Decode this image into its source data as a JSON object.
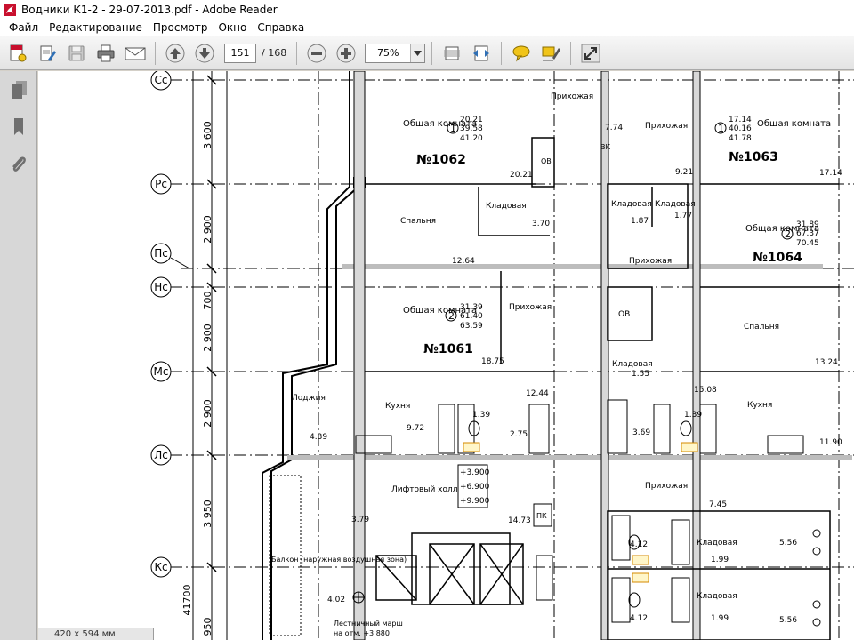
{
  "window": {
    "title": "Водники К1-2 - 29-07-2013.pdf - Adobe Reader"
  },
  "menu": [
    "Файл",
    "Редактирование",
    "Просмотр",
    "Окно",
    "Справка"
  ],
  "toolbar": {
    "page_current": "151",
    "page_total": "/ 168",
    "zoom": "75%"
  },
  "status": {
    "page_size": "420 x 594 мм"
  },
  "colors": {
    "accent": "#2f6fb5",
    "sticky_note": "#f0c419",
    "toolbar_bg": "#ebebeb"
  },
  "drawing": {
    "axes": [
      {
        "label": "Сс"
      },
      {
        "label": "Рс"
      },
      {
        "label": "Пс"
      },
      {
        "label": "Нс"
      },
      {
        "label": "Мс"
      },
      {
        "label": "Лс"
      },
      {
        "label": "Кс"
      }
    ],
    "dimensions": [
      "3 600",
      "2 900",
      "700",
      "2 900",
      "2 900",
      "3 950",
      "41700",
      "950"
    ],
    "rooms": {
      "r1062_label": "№1062",
      "r1062_type": "Общая комната",
      "r1062_num": "1",
      "r1062_areas": [
        "20.21",
        "39.58",
        "41.20"
      ],
      "r1062_area_room": "20.21",
      "r1063_label": "№1063",
      "r1063_type": "Общая комната",
      "r1063_num": "1",
      "r1063_areas": [
        "17.14",
        "40.16",
        "41.78"
      ],
      "r1063_area_room": "17.14",
      "r1064_label": "№1064",
      "r1064_type": "Общая комната",
      "r1064_num": "2",
      "r1064_areas": [
        "31.89",
        "67.37",
        "70.45"
      ],
      "r1061_label": "№1061",
      "r1061_type": "Общая комната",
      "r1061_num": "2",
      "r1061_areas": [
        "31.39",
        "61.40",
        "63.59"
      ],
      "r1061_area_room": "18.75",
      "spalnya": "Спальня",
      "spalnya_area": "12.64",
      "spalnya2_area": "13.24",
      "kladovaya": "Кладовая",
      "kladovaya_area": "3.70",
      "kladovaya2_area": "1.87",
      "kladovaya3_area": "1.77",
      "kladovaya4_area": "1.55",
      "kladovaya5_area": "1.99",
      "kladovaya6_area": "1.99",
      "prikhozhaya": "Прихожая",
      "prikhozhaya_area": "7.74",
      "prikhozhaya2_area": "9.21",
      "prikhozhaya3_area": "15.08",
      "prikhozhaya4_area": "7.45",
      "kukhnya": "Кухня",
      "kukhnya_area": "9.72",
      "kukhnya_area2": "12.44",
      "kukhnya2_area": "11.90",
      "bath_area": "1.39",
      "bath_area2": "2.75",
      "bath2_area": "1.39",
      "bath2_area2": "3.69",
      "bath3_area": "4.12",
      "bath4_area": "4.12",
      "room556": "5.56",
      "room556b": "5.56",
      "lodzhiya": "Лоджия",
      "lodzhiya_area": "4.39",
      "lift_hall": "Лифтовый холл",
      "lift_hall_area": "14.73",
      "level_1": "+3.900",
      "level_2": "+6.900",
      "level_3": "+9.900",
      "pk": "ПК",
      "ov": "ОВ",
      "ov2": "ОВ",
      "vk": "ВК",
      "balcony": "Балкон (наружная воздушная зона)",
      "balcony_area": "3.79",
      "balcony_area2": "4.02",
      "stairs": "Лестничный марш",
      "stairs_level": "на отм. +3.880"
    }
  }
}
